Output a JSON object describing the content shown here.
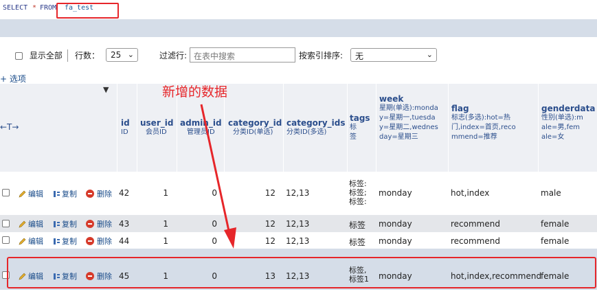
{
  "sql": {
    "select": "SELECT",
    "star": "*",
    "from": "FROM",
    "table": "fa_test"
  },
  "controls": {
    "show_all": "显示全部",
    "rows_label": "行数：",
    "rows_value": "25",
    "filter_label": "过滤行:",
    "filter_placeholder": "在表中搜索",
    "sort_label": "按索引排序:",
    "sort_value": "无"
  },
  "options_link": "+ 选项",
  "nav_arrows": "←T→",
  "annotation": "新增的数据",
  "columns": [
    {
      "name": "id",
      "comment": "ID"
    },
    {
      "name": "user_id",
      "comment": "会员ID"
    },
    {
      "name": "admin_id",
      "comment": "管理员ID"
    },
    {
      "name": "category_id",
      "comment": "分类ID(单选)"
    },
    {
      "name": "category_ids",
      "comment": "分类ID(多选)"
    },
    {
      "name": "tags",
      "comment": "标签"
    },
    {
      "name": "week",
      "comment": "星期(单选):monday=星期一,tuesday=星期二,wednesday=星期三"
    },
    {
      "name": "flag",
      "comment": "标志(多选):hot=热门,index=首页,recommend=推荐"
    },
    {
      "name": "genderdata",
      "comment": "性别(单选):male=男,female=女"
    }
  ],
  "actions": {
    "edit": "编辑",
    "copy": "复制",
    "delete": "删除"
  },
  "rows": [
    {
      "id": "42",
      "user_id": "1",
      "admin_id": "0",
      "category_id": "12",
      "category_ids": "12,13",
      "tags": "标签:\n标签;\n标签:",
      "week": "monday",
      "flag": "hot,index",
      "gender": "male"
    },
    {
      "id": "43",
      "user_id": "1",
      "admin_id": "0",
      "category_id": "12",
      "category_ids": "12,13",
      "tags": "标签",
      "week": "monday",
      "flag": "recommend",
      "gender": "female"
    },
    {
      "id": "44",
      "user_id": "1",
      "admin_id": "0",
      "category_id": "12",
      "category_ids": "12,13",
      "tags": "标签",
      "week": "monday",
      "flag": "recommend",
      "gender": "female"
    },
    {
      "id": "45",
      "user_id": "1",
      "admin_id": "0",
      "category_id": "13",
      "category_ids": "12,13",
      "tags": "标签,\n标签1",
      "week": "monday",
      "flag": "hot,index,recommend",
      "gender": "female"
    }
  ],
  "colors": {
    "accent_red": "#e6262a",
    "header_bg": "#eef0f4",
    "selected_row_bg": "#d5dde8"
  }
}
